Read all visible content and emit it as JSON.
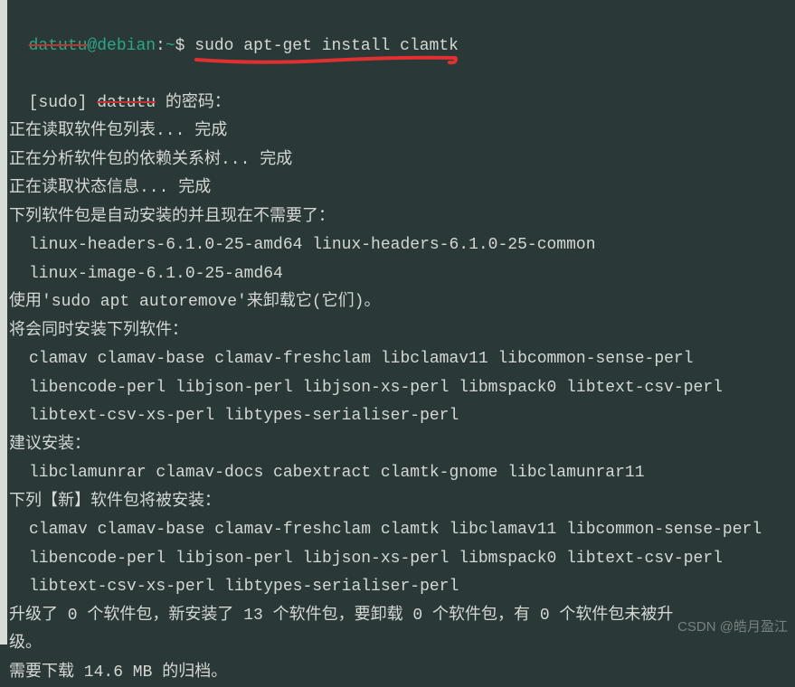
{
  "prompt": {
    "user": "datutu",
    "at": "@",
    "host": "debian",
    "colon": ":",
    "path": "~",
    "dollar": "$ ",
    "command": "sudo apt-get install clamtk"
  },
  "lines": {
    "sudo_prefix": "[sudo] ",
    "sudo_masked": "datutu",
    "sudo_suffix": " 的密码：",
    "reading_pkg": "正在读取软件包列表... 完成",
    "deps_tree": "正在分析软件包的依赖关系树... 完成",
    "reading_state": "正在读取状态信息... 完成",
    "auto_not_needed": "下列软件包是自动安装的并且现在不需要了：",
    "auto_pkg1": "linux-headers-6.1.0-25-amd64 linux-headers-6.1.0-25-common",
    "auto_pkg2": "linux-image-6.1.0-25-amd64",
    "autoremove": "使用'sudo apt autoremove'来卸载它(它们)。",
    "also_install": "将会同时安装下列软件：",
    "also_pkg1": "clamav clamav-base clamav-freshclam libclamav11 libcommon-sense-perl",
    "also_pkg2": "libencode-perl libjson-perl libjson-xs-perl libmspack0 libtext-csv-perl",
    "also_pkg3": "libtext-csv-xs-perl libtypes-serialiser-perl",
    "suggested": "建议安装：",
    "suggested_pkg": "libclamunrar clamav-docs cabextract clamtk-gnome libclamunrar11",
    "new_install": "下列【新】软件包将被安装：",
    "new_pkg1": "clamav clamav-base clamav-freshclam clamtk libclamav11 libcommon-sense-perl",
    "new_pkg2": "libencode-perl libjson-perl libjson-xs-perl libmspack0 libtext-csv-perl",
    "new_pkg3": "libtext-csv-xs-perl libtypes-serialiser-perl",
    "summary1": "升级了 0 个软件包，新安装了 13 个软件包，要卸载 0 个软件包，有 0 个软件包未被升",
    "summary2": "级。",
    "download": "需要下载 14.6 MB 的归档。"
  },
  "watermark": "CSDN @皓月盈江"
}
